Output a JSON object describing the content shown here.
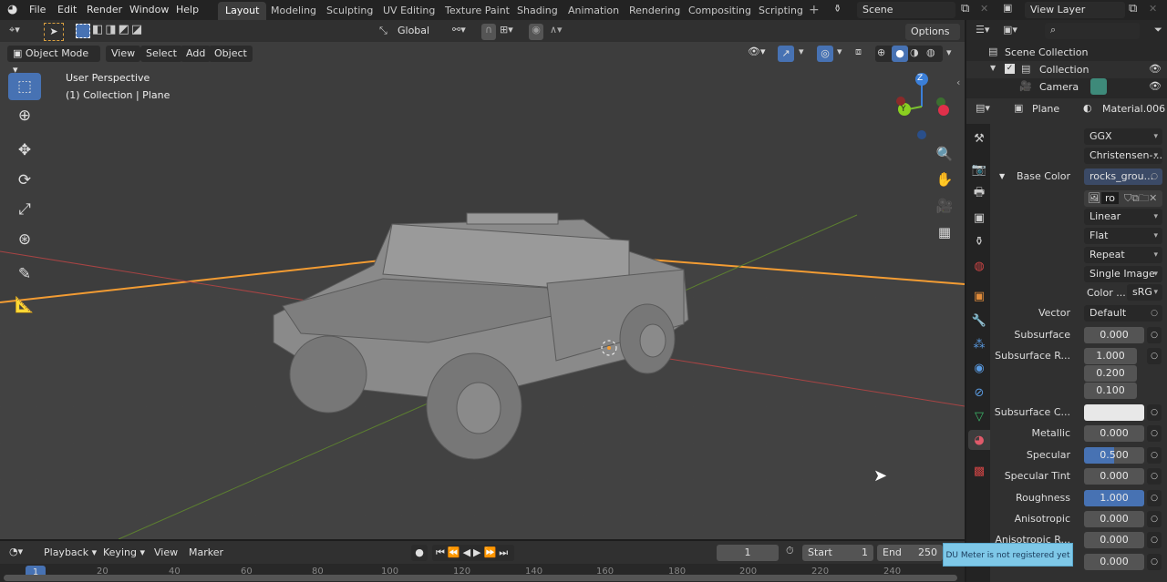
{
  "menu": [
    "File",
    "Edit",
    "Render",
    "Window",
    "Help"
  ],
  "workspaces": [
    "Layout",
    "Modeling",
    "Sculpting",
    "UV Editing",
    "Texture Paint",
    "Shading",
    "Animation",
    "Rendering",
    "Compositing",
    "Scripting"
  ],
  "scene": "Scene",
  "view_layer": "View Layer",
  "tool_header": {
    "orientation": "Global",
    "options": "Options"
  },
  "viewport_header": {
    "mode": "Object Mode",
    "menus": [
      "View",
      "Select",
      "Add",
      "Object"
    ]
  },
  "viewport": {
    "perspective": "User Perspective",
    "context": "(1) Collection | Plane"
  },
  "gizmo": {
    "z": "Z",
    "y": "Y"
  },
  "outliner": {
    "search_placeholder": "",
    "items": [
      "Scene Collection",
      "Collection",
      "Camera"
    ]
  },
  "properties": {
    "object": "Plane",
    "material": "Material.006",
    "distribution": "GGX",
    "subsurface_method": "Christensen-...",
    "base_color_label": "Base Color",
    "base_color_value": "rocks_grou...",
    "image_name": "ro",
    "interpolation": "Linear",
    "projection": "Flat",
    "extension": "Repeat",
    "source": "Single Image",
    "color_space_label": "Color ...",
    "color_space": "sRG",
    "vector_label": "Vector",
    "vector_value": "Default",
    "subsurface_label": "Subsurface",
    "subsurface": "0.000",
    "subsurface_radius_label": "Subsurface R...",
    "subsurface_radius": [
      "1.000",
      "0.200",
      "0.100"
    ],
    "subsurface_color_label": "Subsurface C...",
    "metallic_label": "Metallic",
    "metallic": "0.000",
    "specular_label": "Specular",
    "specular": "0.500",
    "specular_fill": 0.5,
    "specular_tint_label": "Specular Tint",
    "specular_tint": "0.000",
    "roughness_label": "Roughness",
    "roughness": "1.000",
    "roughness_fill": 1.0,
    "anisotropic_label": "Anisotropic",
    "anisotropic": "0.000",
    "anisotropic_r_label": "Anisotropic R...",
    "anisotropic_r": "0.000",
    "next_value": "0.000"
  },
  "timeline": {
    "menus": [
      "Playback",
      "Keying",
      "View",
      "Marker"
    ],
    "current_frame": "1",
    "start_label": "Start",
    "start": "1",
    "end_label": "End",
    "end": "250",
    "ticks": [
      "20",
      "40",
      "60",
      "80",
      "100",
      "120",
      "140",
      "160",
      "180",
      "200",
      "220",
      "240"
    ],
    "frame_marker": "1"
  },
  "notification": "DU Meter is not registered yet",
  "colors": {
    "accent": "#4772b3",
    "x_axis": "#c43b3b",
    "y_axis": "#6a9a2a",
    "selection": "#f39c33",
    "notification": "#7ec8e8"
  }
}
